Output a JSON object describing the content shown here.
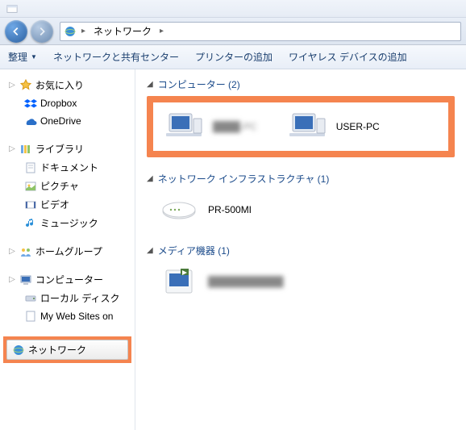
{
  "titlebar": {},
  "nav": {
    "breadcrumb_icon": "network-icon",
    "breadcrumb_text": "ネットワーク"
  },
  "toolbar": {
    "organize": "整理",
    "network_center": "ネットワークと共有センター",
    "add_printer": "プリンターの追加",
    "add_wireless": "ワイヤレス デバイスの追加"
  },
  "sidebar": {
    "favorites": {
      "label": "お気に入り",
      "children": [
        {
          "label": "Dropbox",
          "icon": "dropbox-icon",
          "color": "#0061ff"
        },
        {
          "label": "OneDrive",
          "icon": "onedrive-icon",
          "color": "#2a5fa0"
        }
      ]
    },
    "libraries": {
      "label": "ライブラリ",
      "children": [
        {
          "label": "ドキュメント",
          "icon": "document-icon"
        },
        {
          "label": "ピクチャ",
          "icon": "picture-icon"
        },
        {
          "label": "ビデオ",
          "icon": "video-icon"
        },
        {
          "label": "ミュージック",
          "icon": "music-icon",
          "color": "#2a8fd8"
        }
      ]
    },
    "homegroup": {
      "label": "ホームグループ"
    },
    "computer": {
      "label": "コンピューター",
      "children": [
        {
          "label": "ローカル ディスク",
          "icon": "disk-icon"
        },
        {
          "label": "My Web Sites on",
          "icon": "page-icon"
        }
      ]
    },
    "network": {
      "label": "ネットワーク"
    }
  },
  "sections": {
    "computers": {
      "title": "コンピューター (2)",
      "items": [
        {
          "label": "████-PC",
          "blurred": true
        },
        {
          "label": "USER-PC",
          "blurred": false
        }
      ]
    },
    "infra": {
      "title": "ネットワーク インフラストラクチャ (1)",
      "items": [
        {
          "label": "PR-500MI"
        }
      ]
    },
    "media": {
      "title": "メディア機器 (1)",
      "items": [
        {
          "label": "███████████",
          "blurred": true
        }
      ]
    }
  }
}
